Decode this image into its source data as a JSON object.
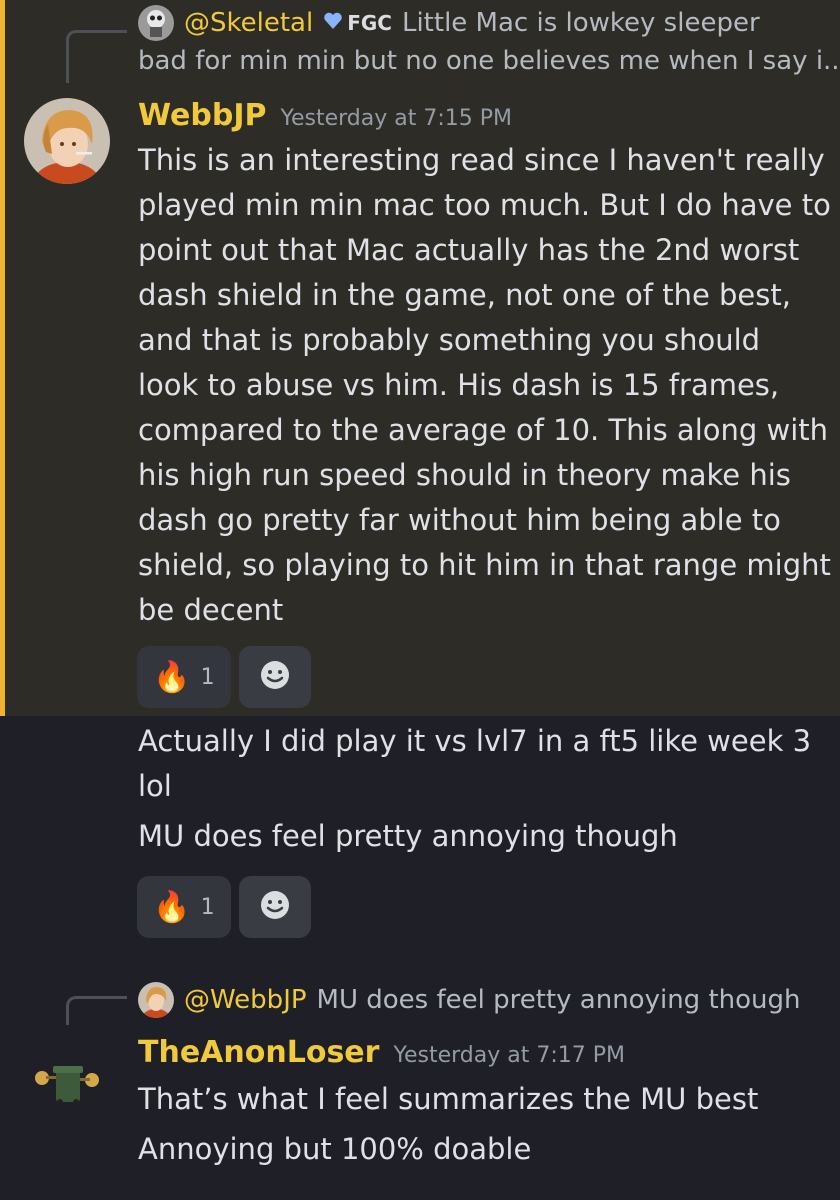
{
  "colors": {
    "highlight_bg": "#2e2c27",
    "highlight_bar": "#f0b232",
    "author_name": "#f0c93c",
    "reply_name": "#f0c93c",
    "background": "#1f2027"
  },
  "reply_1": {
    "name": "@Skeletal",
    "tag_icon": "heart-icon",
    "tag": "FGC",
    "text_line1": "Little Mac is lowkey sleeper",
    "text_line2": "bad for min min but no one believes me when I say i..."
  },
  "message_1": {
    "author": "WebbJP",
    "timestamp": "Yesterday at 7:15 PM",
    "lines": [
      "This is an interesting read since I haven't really",
      "played min min mac too much. But I do have to",
      "point out that Mac actually has the 2nd worst",
      "dash shield in the game, not one of the best,",
      "and that is probably something you should",
      "look to abuse vs him. His dash is 15 frames,",
      "compared to the average of 10. This along with",
      "his high run speed should in theory make his",
      "dash go pretty far without him being able to",
      "shield, so playing to hit him in that range might",
      "be decent"
    ],
    "reaction": {
      "emoji": "🔥",
      "count": "1"
    }
  },
  "message_2": {
    "lines": [
      "Actually I did play it vs lvl7 in a ft5 like week 3",
      "lol"
    ]
  },
  "message_3": {
    "lines": [
      "MU does feel pretty annoying though"
    ],
    "reaction": {
      "emoji": "🔥",
      "count": "1"
    }
  },
  "reply_2": {
    "name": "@WebbJP",
    "text": "MU does feel pretty annoying though"
  },
  "message_4": {
    "author": "TheAnonLoser",
    "timestamp": "Yesterday at 7:17 PM",
    "lines": [
      "That’s what I feel summarizes the MU best",
      "Annoying but 100% doable"
    ]
  }
}
